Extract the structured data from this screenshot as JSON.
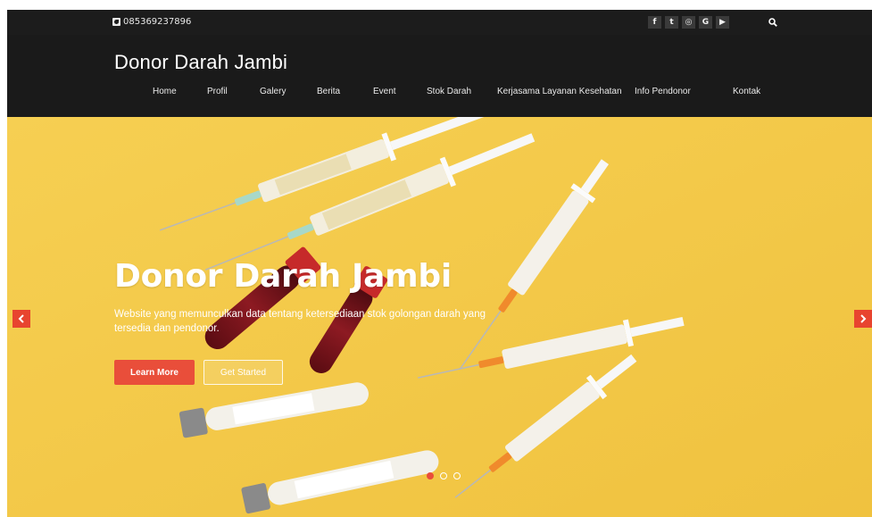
{
  "topbar": {
    "phone": "085369237896",
    "socials": [
      {
        "icon": "facebook-icon",
        "glyph": "f"
      },
      {
        "icon": "twitter-icon",
        "glyph": "t"
      },
      {
        "icon": "instagram-icon",
        "glyph": "◎"
      },
      {
        "icon": "google-icon",
        "glyph": "G"
      },
      {
        "icon": "youtube-icon",
        "glyph": "▶"
      }
    ]
  },
  "header": {
    "brand": "Donor Darah Jambi",
    "nav": [
      "Home",
      "Profil",
      "Galery",
      "Berita",
      "Event",
      "Stok Darah",
      "Kerjasama Layanan Kesehatan",
      "Info Pendonor",
      "Kontak"
    ]
  },
  "hero": {
    "title": "Donor Darah Jambi",
    "subtitle": "Website yang memunculkan data tentang ketersediaan stok golongan darah yang tersedia dan pendonor.",
    "learn_more": "Learn More",
    "get_started": "Get Started",
    "slide_count": 3,
    "active_slide": 1
  },
  "colors": {
    "accent": "#e94e3a",
    "header_bg": "#1a1a1a",
    "hero_bg": "#f3c94a"
  }
}
